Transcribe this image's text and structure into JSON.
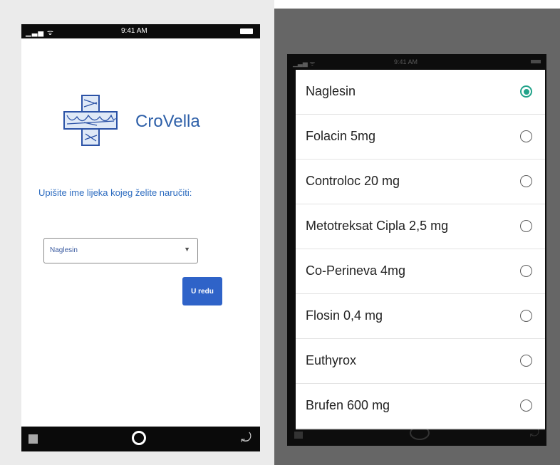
{
  "left_phone": {
    "status_bar": {
      "signal": "▁▃▅ ᯤ",
      "time": "9:41 AM"
    },
    "brand": "CroVella",
    "prompt": "Upišite ime lijeka kojeg želite naručiti:",
    "select": {
      "value": "Naglesin"
    },
    "ok_button": "U redu"
  },
  "right_phone": {
    "status_bar": {
      "signal": "▁▃▅ ᯤ",
      "time": "9:41 AM"
    },
    "options": [
      {
        "label": "Naglesin",
        "selected": true
      },
      {
        "label": "Folacin 5mg",
        "selected": false
      },
      {
        "label": "Controloc 20 mg",
        "selected": false
      },
      {
        "label": "Metotreksat Cipla 2,5 mg",
        "selected": false
      },
      {
        "label": "Co-Perineva 4mg",
        "selected": false
      },
      {
        "label": "Flosin 0,4 mg",
        "selected": false
      },
      {
        "label": "Euthyrox",
        "selected": false
      },
      {
        "label": "Brufen 600 mg",
        "selected": false
      }
    ]
  },
  "colors": {
    "accent": "#2f63c8",
    "radio_selected": "#22a38a",
    "brand_text": "#2d5fa8"
  }
}
